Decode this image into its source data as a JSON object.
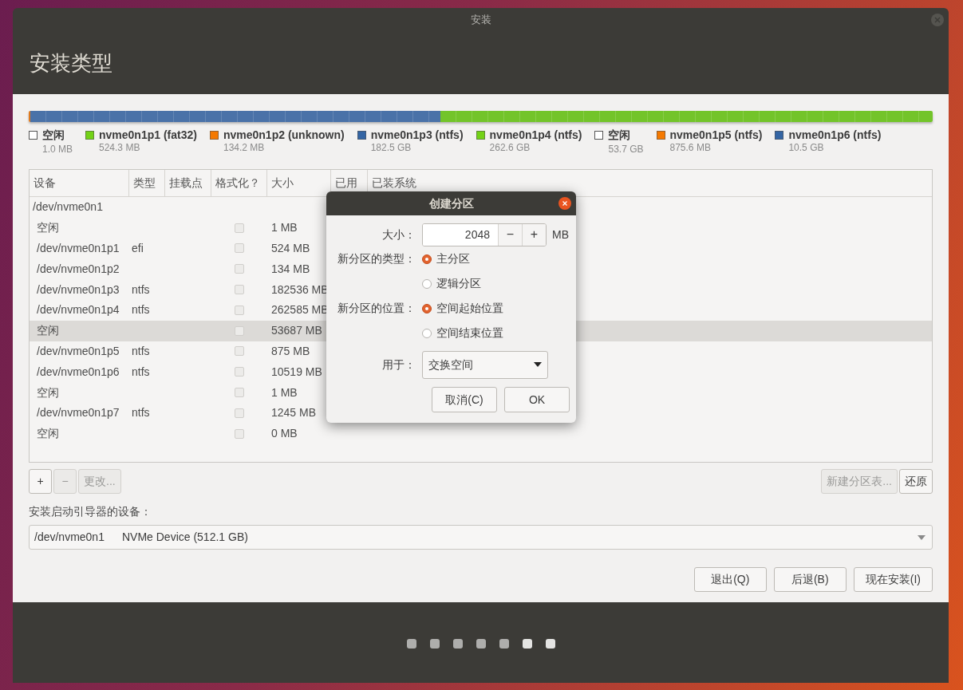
{
  "window": {
    "title": "安装"
  },
  "header": {
    "title": "安装类型"
  },
  "partition_bar": {
    "segments": [
      {
        "color": "#e07a1e",
        "level": 0.002
      },
      {
        "color": "#4a72a8",
        "level": 0.453
      },
      {
        "color": "#73c42a",
        "level": 0.545
      }
    ]
  },
  "legend": [
    {
      "name": "空闲",
      "size": "1.0 MB",
      "color": "#ffffff",
      "kind": "free"
    },
    {
      "name": "nvme0n1p1 (fat32)",
      "size": "524.3 MB",
      "color": "#73d216",
      "kind": "partition"
    },
    {
      "name": "nvme0n1p2 (unknown)",
      "size": "134.2 MB",
      "color": "#f57900",
      "kind": "partition"
    },
    {
      "name": "nvme0n1p3 (ntfs)",
      "size": "182.5 GB",
      "color": "#3465a4",
      "kind": "partition"
    },
    {
      "name": "nvme0n1p4 (ntfs)",
      "size": "262.6 GB",
      "color": "#73d216",
      "kind": "partition"
    },
    {
      "name": "空闲",
      "size": "53.7 GB",
      "color": "#ffffff",
      "kind": "free"
    },
    {
      "name": "nvme0n1p5 (ntfs)",
      "size": "875.6 MB",
      "color": "#f57900",
      "kind": "partition"
    },
    {
      "name": "nvme0n1p6 (ntfs)",
      "size": "10.5 GB",
      "color": "#3465a4",
      "kind": "partition"
    }
  ],
  "table": {
    "columns": [
      "设备",
      "类型",
      "挂载点",
      "格式化？",
      "大小",
      "已用",
      "已装系统"
    ],
    "rows": [
      {
        "kind": "disk",
        "device": "/dev/nvme0n1",
        "selected": false
      },
      {
        "kind": "partition",
        "device": "空闲",
        "type": "",
        "format_checked": false,
        "size": "1 MB",
        "selected": false
      },
      {
        "kind": "partition",
        "device": "/dev/nvme0n1p1",
        "type": "efi",
        "format_checked": false,
        "size": "524 MB",
        "selected": false
      },
      {
        "kind": "partition",
        "device": "/dev/nvme0n1p2",
        "type": "",
        "format_checked": false,
        "size": "134 MB",
        "selected": false
      },
      {
        "kind": "partition",
        "device": "/dev/nvme0n1p3",
        "type": "ntfs",
        "format_checked": false,
        "size": "182536 MB",
        "selected": false
      },
      {
        "kind": "partition",
        "device": "/dev/nvme0n1p4",
        "type": "ntfs",
        "format_checked": false,
        "size": "262585 MB",
        "selected": false
      },
      {
        "kind": "partition",
        "device": "空闲",
        "type": "",
        "format_checked": false,
        "size": "53687 MB",
        "selected": true
      },
      {
        "kind": "partition",
        "device": "/dev/nvme0n1p5",
        "type": "ntfs",
        "format_checked": false,
        "size": "875 MB",
        "selected": false
      },
      {
        "kind": "partition",
        "device": "/dev/nvme0n1p6",
        "type": "ntfs",
        "format_checked": false,
        "size": "10519 MB",
        "selected": false
      },
      {
        "kind": "partition",
        "device": "空闲",
        "type": "",
        "format_checked": false,
        "size": "1 MB",
        "selected": false
      },
      {
        "kind": "partition",
        "device": "/dev/nvme0n1p7",
        "type": "ntfs",
        "format_checked": false,
        "size": "1245 MB",
        "selected": false
      },
      {
        "kind": "partition",
        "device": "空闲",
        "type": "",
        "format_checked": false,
        "size": "0 MB",
        "selected": false
      }
    ]
  },
  "table_buttons_left": [
    {
      "label": "+",
      "disabled": false
    },
    {
      "label": "−",
      "disabled": true
    },
    {
      "label": "更改...",
      "disabled": true
    }
  ],
  "table_buttons_right": [
    {
      "label": "新建分区表...",
      "disabled": true
    },
    {
      "label": "还原",
      "disabled": false
    }
  ],
  "boot_loader": {
    "label": "安装启动引导器的设备：",
    "device": "/dev/nvme0n1",
    "description": "NVMe Device (512.1 GB)"
  },
  "nav_buttons": [
    {
      "label": "退出(Q)"
    },
    {
      "label": "后退(B)"
    },
    {
      "label": "现在安装(I)"
    }
  ],
  "progress_dots": [
    {
      "highlighted": false
    },
    {
      "highlighted": false
    },
    {
      "highlighted": false
    },
    {
      "highlighted": false
    },
    {
      "highlighted": false
    },
    {
      "highlighted": true
    },
    {
      "highlighted": true
    }
  ],
  "dialog": {
    "title": "创建分区",
    "size_label": "大小：",
    "size_value": "2048",
    "decrement": "−",
    "increment": "+",
    "unit": "MB",
    "type_label": "新分区的类型：",
    "type_options": [
      {
        "label": "主分区",
        "selected": true
      },
      {
        "label": "逻辑分区",
        "selected": false
      }
    ],
    "location_label": "新分区的位置：",
    "location_options": [
      {
        "label": "空间起始位置",
        "selected": true
      },
      {
        "label": "空间结束位置",
        "selected": false
      }
    ],
    "use_label": "用于：",
    "use_value": "交换空间",
    "buttons": [
      {
        "label": "取消(C)"
      },
      {
        "label": "OK"
      }
    ]
  }
}
